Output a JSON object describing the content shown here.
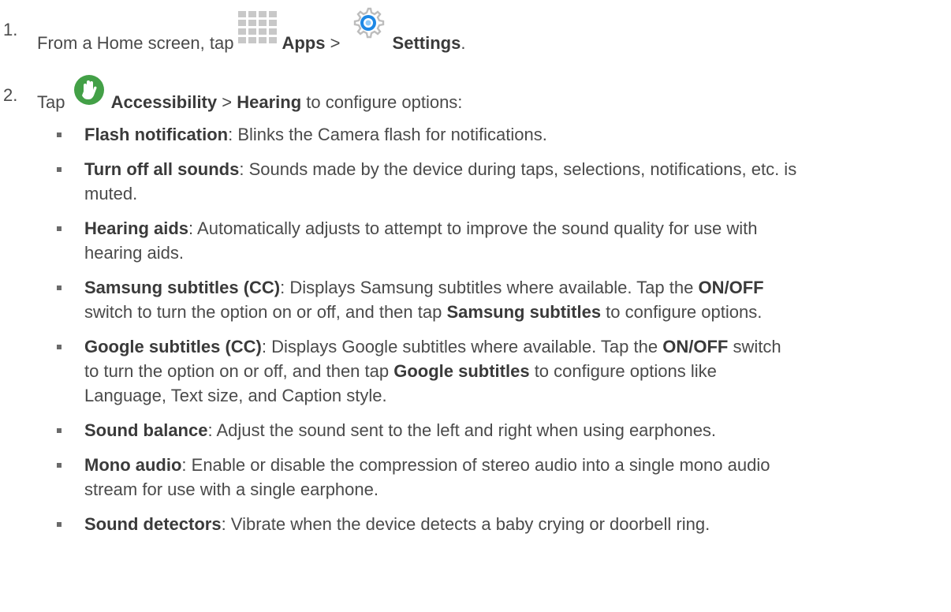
{
  "step1": {
    "number": "1.",
    "pre": "From a Home screen, tap",
    "apps_label": "Apps",
    "separator": ">",
    "settings_label": "Settings",
    "end": "."
  },
  "step2": {
    "number": "2.",
    "pre": "Tap",
    "accessibility_label": "Accessibility",
    "separator": ">",
    "hearing_label": "Hearing",
    "post": "to configure options:"
  },
  "icons": {
    "apps": "apps-grid-icon",
    "settings": "settings-gear-icon",
    "accessibility": "accessibility-hand-icon",
    "accent_blue": "#1e88e5",
    "accent_green": "#43a047"
  },
  "items": [
    {
      "term": "Flash notification",
      "desc": ": Blinks the Camera flash for notifications."
    },
    {
      "term": "Turn off all sounds",
      "desc": ": Sounds made by the device during taps, selections, notifications, etc. is",
      "desc2": "muted."
    },
    {
      "term": "Hearing aids",
      "desc": ": Automatically adjusts to attempt to improve the sound quality for use with",
      "desc2": "hearing aids."
    },
    {
      "term": "Samsung subtitles (CC)",
      "desc": ": Displays Samsung subtitles where available. Tap the ",
      "b1": "ON/OFF",
      "desc2": "switch to turn the option on or off, and then tap ",
      "b2": "Samsung subtitles",
      "desc3": " to configure options."
    },
    {
      "term": "Google subtitles (CC)",
      "desc": ": Displays Google subtitles where available. Tap the ",
      "b1": "ON/OFF",
      "desc1b": " switch",
      "desc2": "to turn the option on or off, and then tap ",
      "b2": "Google subtitles",
      "desc3": " to configure options like",
      "desc4": "Language, Text size, and Caption style."
    },
    {
      "term": "Sound balance",
      "desc": ": Adjust the sound sent to the left and right when using earphones."
    },
    {
      "term": "Mono audio",
      "desc": ": Enable or disable the compression of stereo audio into a single mono audio",
      "desc2": "stream for use with a single earphone."
    },
    {
      "term": "Sound detectors",
      "desc": ": Vibrate when the device detects a baby crying or doorbell ring."
    }
  ]
}
